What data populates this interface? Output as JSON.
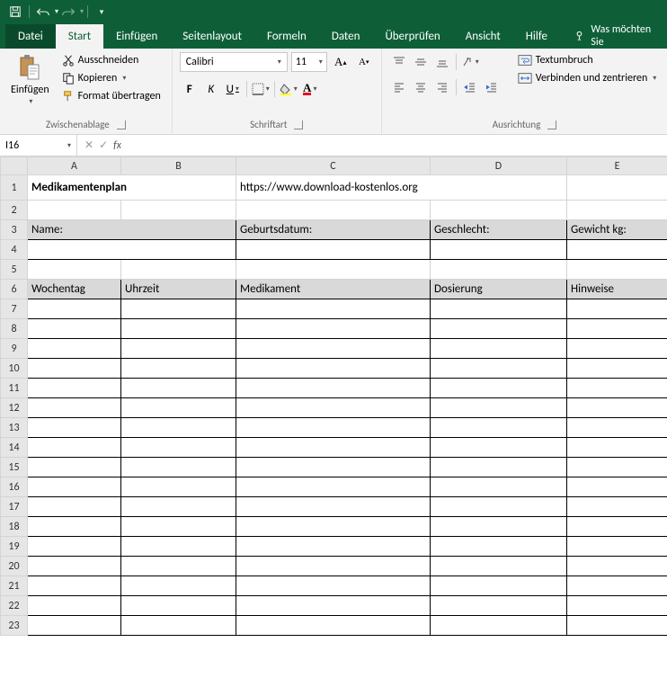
{
  "qat": {
    "save": "save-icon",
    "undo": "undo-icon",
    "redo": "redo-icon"
  },
  "tabs": {
    "file": "Datei",
    "list": [
      "Start",
      "Einfügen",
      "Seitenlayout",
      "Formeln",
      "Daten",
      "Überprüfen",
      "Ansicht",
      "Hilfe"
    ],
    "active": "Start",
    "tellme": "Was möchten Sie"
  },
  "ribbon": {
    "clipboard": {
      "label": "Zwischenablage",
      "paste": "Einfügen",
      "cut": "Ausschneiden",
      "copy": "Kopieren",
      "format_painter": "Format übertragen"
    },
    "font": {
      "label": "Schriftart",
      "name": "Calibri",
      "size": "11",
      "bold": "F",
      "italic": "K",
      "underline": "U"
    },
    "alignment": {
      "label": "Ausrichtung",
      "wrap": "Textumbruch",
      "merge": "Verbinden und zentrieren"
    }
  },
  "namebox": "I16",
  "formula": "",
  "sheet": {
    "columns": [
      "A",
      "B",
      "C",
      "D",
      "E"
    ],
    "title": "Medikamentenplan",
    "url": "https://www.download-kostenlos.org",
    "info_headers": {
      "name": "Name:",
      "dob": "Geburtsdatum:",
      "sex": "Geschlecht:",
      "weight": "Gewicht kg:"
    },
    "table_headers": {
      "day": "Wochentag",
      "time": "Uhrzeit",
      "med": "Medikament",
      "dose": "Dosierung",
      "notes": "Hinweise"
    },
    "row_count": 23
  }
}
